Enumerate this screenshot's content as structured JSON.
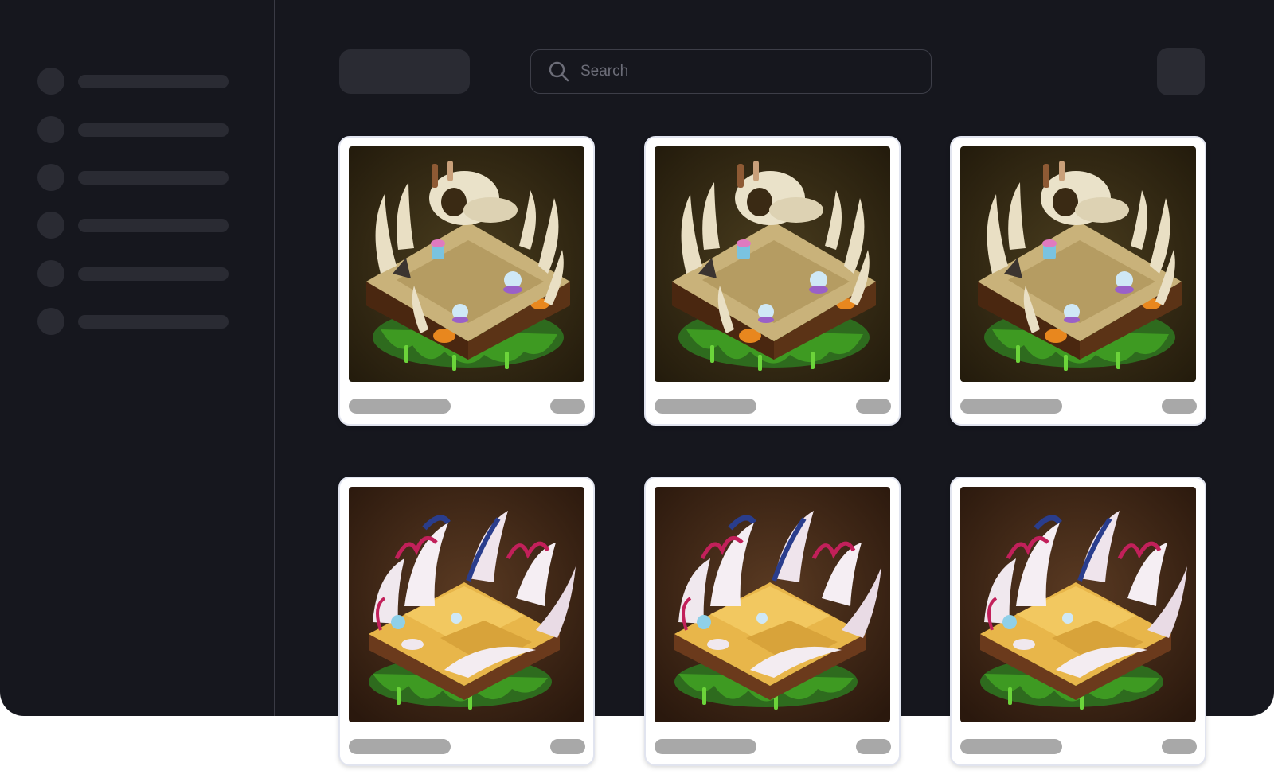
{
  "search": {
    "placeholder": "Search"
  },
  "sidebar": {
    "items": [
      {
        "icon": "placeholder-dot"
      },
      {
        "icon": "placeholder-dot"
      },
      {
        "icon": "placeholder-dot"
      },
      {
        "icon": "placeholder-dot"
      },
      {
        "icon": "placeholder-dot"
      },
      {
        "icon": "placeholder-dot"
      }
    ]
  },
  "cards": [
    {
      "artwork": "bone-island-illustration"
    },
    {
      "artwork": "bone-island-illustration"
    },
    {
      "artwork": "bone-island-illustration"
    },
    {
      "artwork": "shell-island-illustration"
    },
    {
      "artwork": "shell-island-illustration"
    },
    {
      "artwork": "shell-island-illustration"
    }
  ],
  "colors": {
    "app_background": "#16171e",
    "placeholder": "#2a2b33",
    "card_border": "#e1e4ef",
    "card_text_placeholder": "#a8a8a8"
  }
}
